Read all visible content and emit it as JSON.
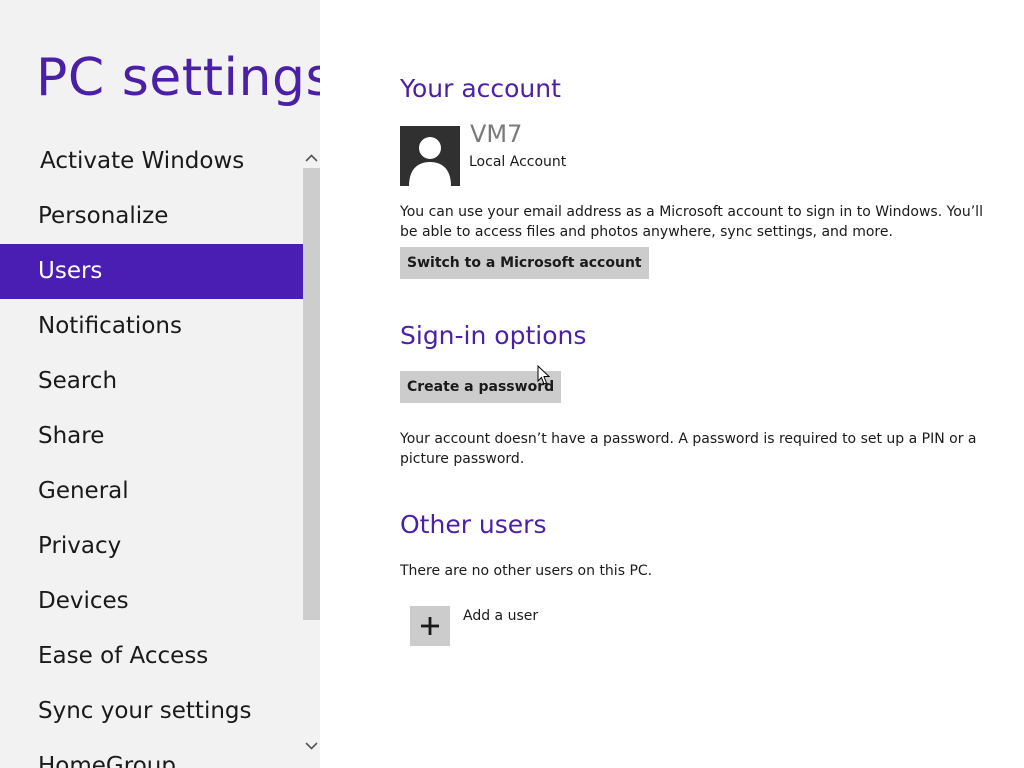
{
  "app": {
    "title": "PC settings"
  },
  "sidebar": {
    "active_index": 2,
    "items": [
      {
        "label": "Activate Windows"
      },
      {
        "label": "Personalize"
      },
      {
        "label": "Users"
      },
      {
        "label": "Notifications"
      },
      {
        "label": "Search"
      },
      {
        "label": "Share"
      },
      {
        "label": "General"
      },
      {
        "label": "Privacy"
      },
      {
        "label": "Devices"
      },
      {
        "label": "Ease of Access"
      },
      {
        "label": "Sync your settings"
      },
      {
        "label": "HomeGroup"
      }
    ]
  },
  "your_account": {
    "heading": "Your account",
    "user_name": "VM7",
    "account_type": "Local Account",
    "description": "You can use your email address as a Microsoft account to sign in to Windows. You’ll be able to access files and photos anywhere, sync settings, and more.",
    "switch_button_label": "Switch to a Microsoft account",
    "avatar_icon": "user-silhouette-icon"
  },
  "sign_in_options": {
    "heading": "Sign-in options",
    "create_password_label": "Create a password",
    "description": "Your account doesn’t have a password. A password is required to set up a PIN or a picture password."
  },
  "other_users": {
    "heading": "Other users",
    "description": "There are no other users on this PC.",
    "add_user_label": "Add a user",
    "add_icon": "plus-icon"
  },
  "colors": {
    "accent": "#4a1db3",
    "title_purple": "#4b1fa6",
    "sidebar_bg": "#f2f2f2",
    "button_bg": "#cccccc"
  }
}
